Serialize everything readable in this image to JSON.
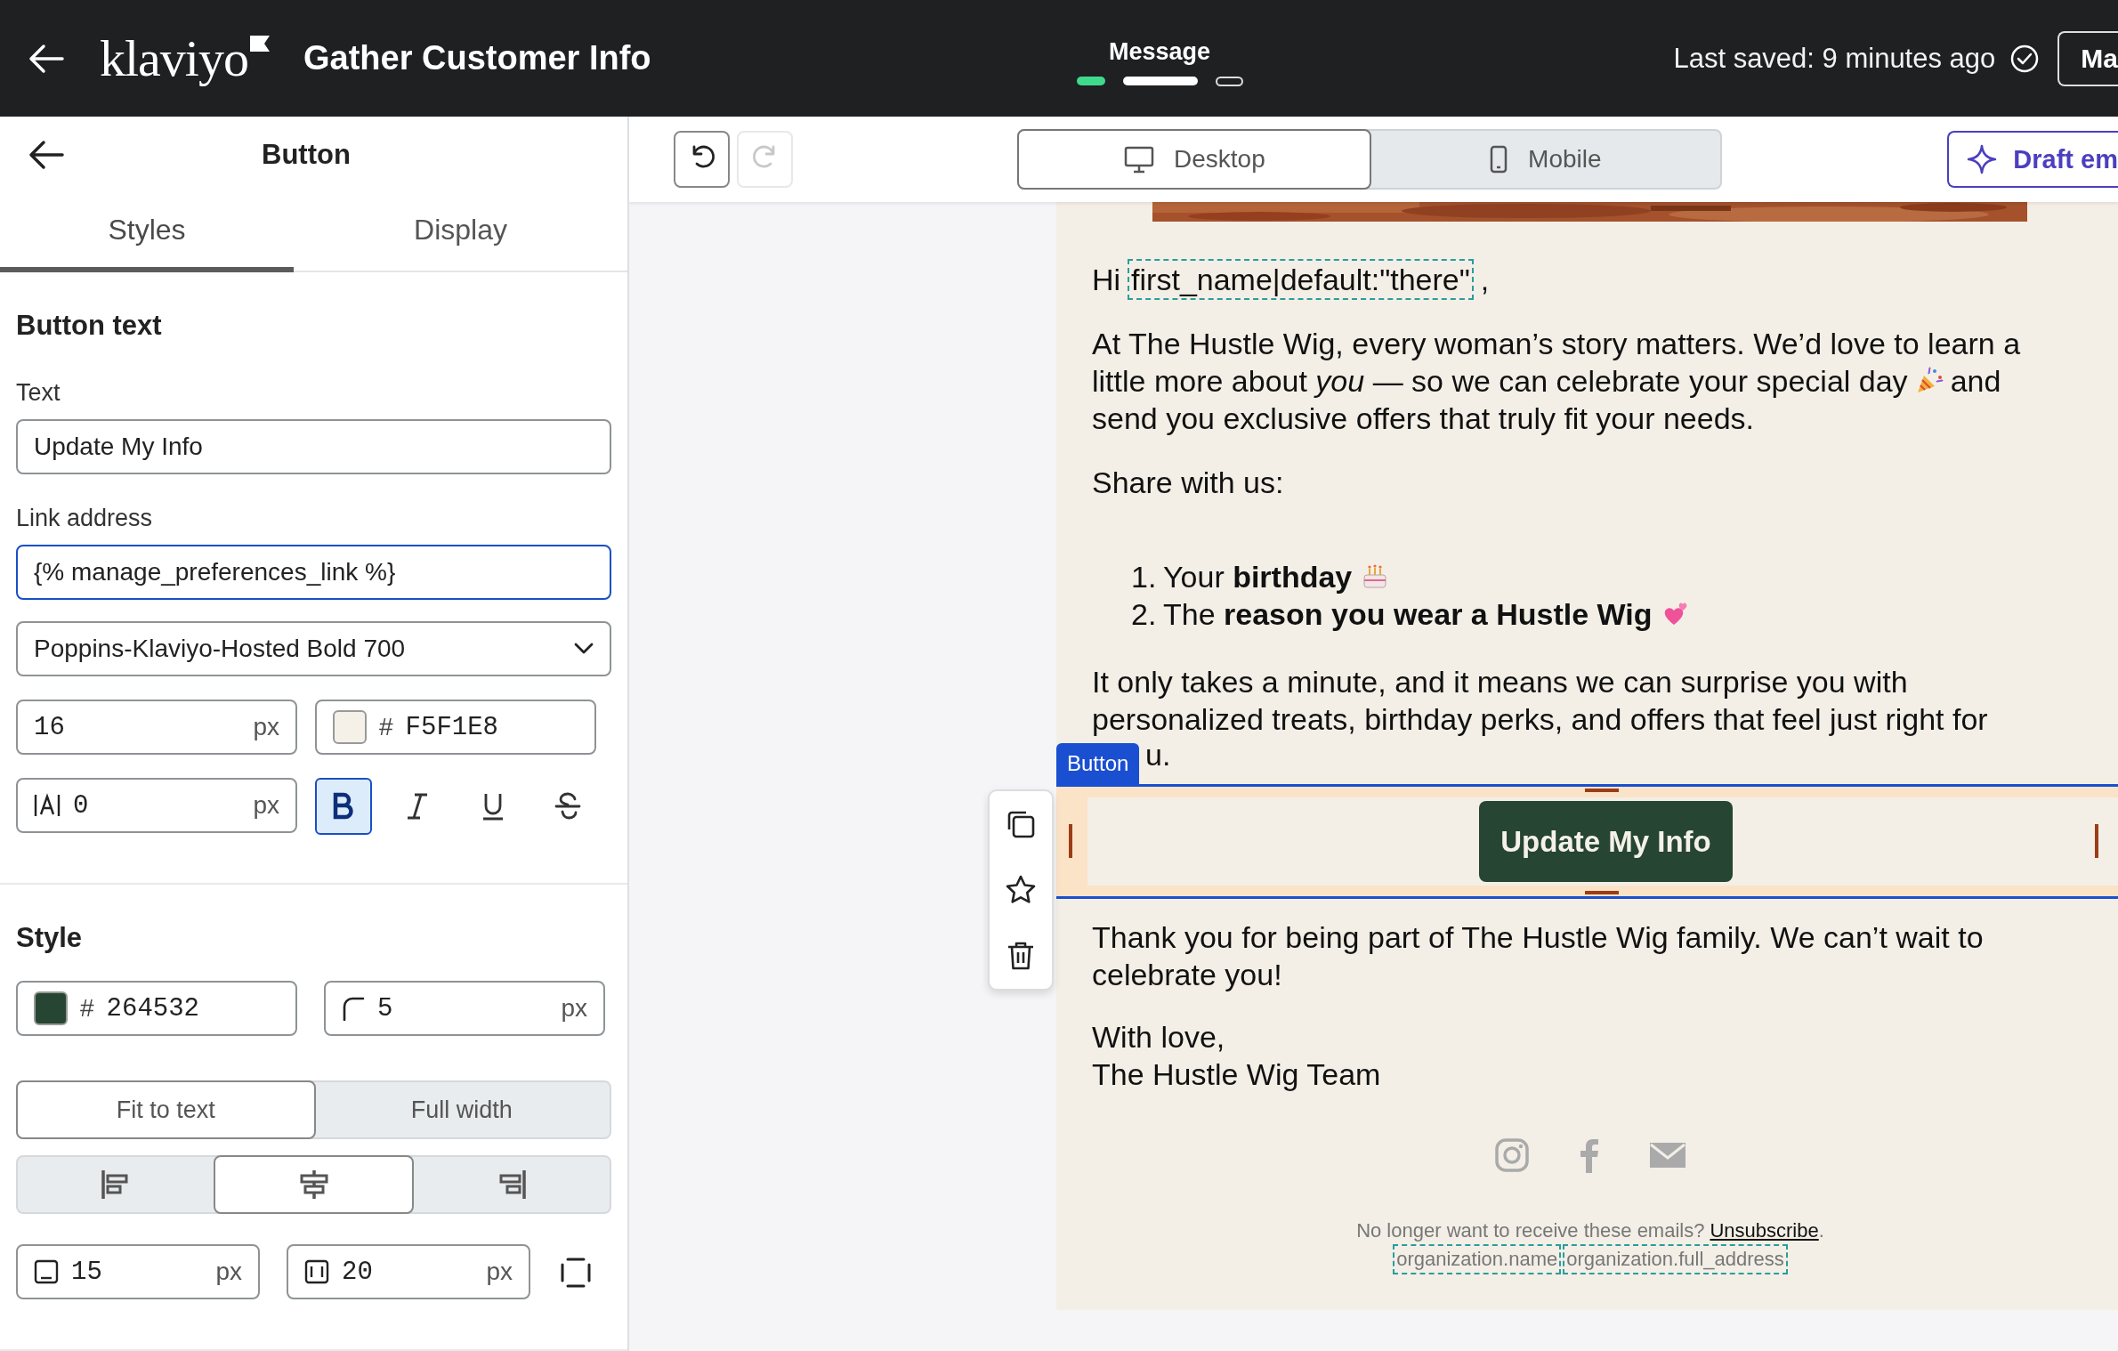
{
  "top_bar": {
    "logo": "klaviyo",
    "title": "Gather Customer Info",
    "step_label": "Message",
    "steps": [
      {
        "kind": "done"
      },
      {
        "kind": "current"
      },
      {
        "kind": "upcoming"
      }
    ],
    "saved_text": "Last saved: 9 minutes ago",
    "button": "Ma"
  },
  "panel": {
    "title": "Button",
    "tabs": [
      {
        "label": "Styles",
        "selected": true
      },
      {
        "label": "Display",
        "selected": false
      }
    ],
    "button_text": {
      "heading": "Button text",
      "text_label": "Text",
      "text_value": "Update My Info",
      "link_label": "Link address",
      "link_value": "{% manage_preferences_link %}",
      "font": "Poppins-Klaviyo-Hosted Bold 700",
      "size": {
        "value": "16",
        "unit": "px"
      },
      "text_color": {
        "prefix": "#",
        "value": "F5F1E8",
        "color": "#f5f1e8"
      },
      "spacing": {
        "value": "0",
        "unit": "px"
      },
      "formats": [
        {
          "kind": "bold",
          "selected": true
        },
        {
          "kind": "italic",
          "selected": false
        },
        {
          "kind": "underline",
          "selected": false
        },
        {
          "kind": "strikethrough",
          "selected": false
        }
      ]
    },
    "style": {
      "heading": "Style",
      "bg_color": {
        "prefix": "#",
        "value": "264532",
        "color": "#264532"
      },
      "radius": {
        "value": "5",
        "unit": "px"
      },
      "width_options": [
        {
          "label": "Fit to text",
          "selected": true
        },
        {
          "label": "Full width",
          "selected": false
        }
      ],
      "align_options": [
        {
          "kind": "left",
          "selected": false
        },
        {
          "kind": "center",
          "selected": true
        },
        {
          "kind": "right",
          "selected": false
        }
      ],
      "padding_v": {
        "value": "15",
        "unit": "px"
      },
      "padding_h": {
        "value": "20",
        "unit": "px"
      }
    }
  },
  "toolbar": {
    "history": [
      {
        "kind": "undo",
        "disabled": false
      },
      {
        "kind": "redo",
        "disabled": true
      }
    ],
    "devices": [
      {
        "kind": "desktop",
        "label": "Desktop",
        "selected": true
      },
      {
        "kind": "mobile",
        "label": "Mobile",
        "selected": false
      }
    ],
    "draft_button": "Draft em"
  },
  "email": {
    "header_image": {
      "kind": "picture"
    },
    "greeting": {
      "prefix": "Hi",
      "variable": "first_name|default:\"there\"",
      "suffix": ","
    },
    "intro": [
      {
        "text": "At The Hustle Wig, every woman’s story matters. We’d love to learn a"
      },
      {
        "text": "little more about *you* — so we can celebrate your special day",
        "after_icon": "and"
      },
      {
        "text": "send you exclusive offers that truly fit your needs."
      }
    ],
    "share": "Share with us:",
    "list": [
      {
        "number": "1.",
        "text": "Your **birthday**"
      },
      {
        "number": "2.",
        "text": "The **reason you wear a Hustle Wig**"
      }
    ],
    "outro": [
      "It only takes a minute, and it means we can surprise you with",
      "personalized treats, birthday perks, and offers that feel just right for"
    ],
    "outro_tail": "u.",
    "block_label": "Button",
    "cta": "Update My Info",
    "thanks": [
      "Thank you for being part of The Hustle Wig family. We can’t wait to",
      "celebrate you!"
    ],
    "signoff": [
      "With love,",
      "The Hustle Wig Team"
    ],
    "social": [
      {
        "kind": "instagram"
      },
      {
        "kind": "facebook"
      },
      {
        "kind": "email"
      }
    ],
    "footer": {
      "text": "No longer want to receive these emails?",
      "link": "Unsubscribe",
      "end": ".",
      "variables": [
        "organization.name",
        "organization.full_address"
      ]
    }
  }
}
